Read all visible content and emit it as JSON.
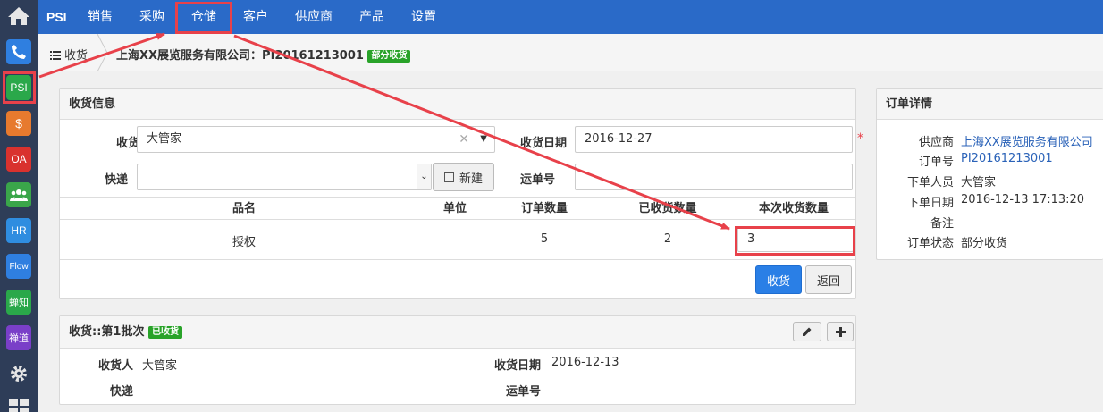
{
  "nav": {
    "brand": "PSI",
    "items": [
      "销售",
      "采购",
      "仓储",
      "客户",
      "供应商",
      "产品",
      "设置"
    ]
  },
  "apps": {
    "psi": "PSI",
    "money": "$",
    "oa": "OA",
    "hr": "HR",
    "flow": "Flow",
    "zhi": "蝉知",
    "dao": "禅道"
  },
  "breadcrumb": {
    "home": "收货",
    "title": "上海XX展览服务有限公司：PI20161213001",
    "status": "部分收货"
  },
  "receipt": {
    "panel_title": "收货信息",
    "receiver_label": "收货人",
    "receiver_value": "大管家",
    "date_label": "收货日期",
    "date_value": "2016-12-27",
    "courier_label": "快递",
    "courier_value": "",
    "new_label": "新建",
    "tracking_label": "运单号",
    "tracking_value": "",
    "table": {
      "headers": [
        "品名",
        "单位",
        "订单数量",
        "已收货数量",
        "本次收货数量"
      ],
      "row": {
        "name": "授权",
        "unit": "",
        "ordered": "5",
        "received": "2",
        "current": "3"
      }
    },
    "submit_label": "收货",
    "back_label": "返回"
  },
  "batch": {
    "title": "收货::第1批次",
    "status": "已收货",
    "receiver_label": "收货人",
    "receiver_value": "大管家",
    "date_label": "收货日期",
    "date_value": "2016-12-13",
    "courier_label": "快递",
    "courier_value": "",
    "tracking_label": "运单号",
    "tracking_value": ""
  },
  "order": {
    "panel_title": "订单详情",
    "supplier_label": "供应商",
    "supplier_value": "上海XX展览服务有限公司",
    "order_no_label": "订单号",
    "order_no_value": "PI20161213001",
    "creator_label": "下单人员",
    "creator_value": "大管家",
    "created_label": "下单日期",
    "created_value": "2016-12-13 17:13:20",
    "note_label": "备注",
    "note_value": "",
    "status_label": "订单状态",
    "status_value": "部分收货"
  },
  "colors": {
    "nav_bg": "#2a6ac8",
    "appbar_bg": "#2e3d58",
    "primary": "#2a7fe6",
    "annotation": "#e8414a",
    "badge": "#29a329"
  }
}
